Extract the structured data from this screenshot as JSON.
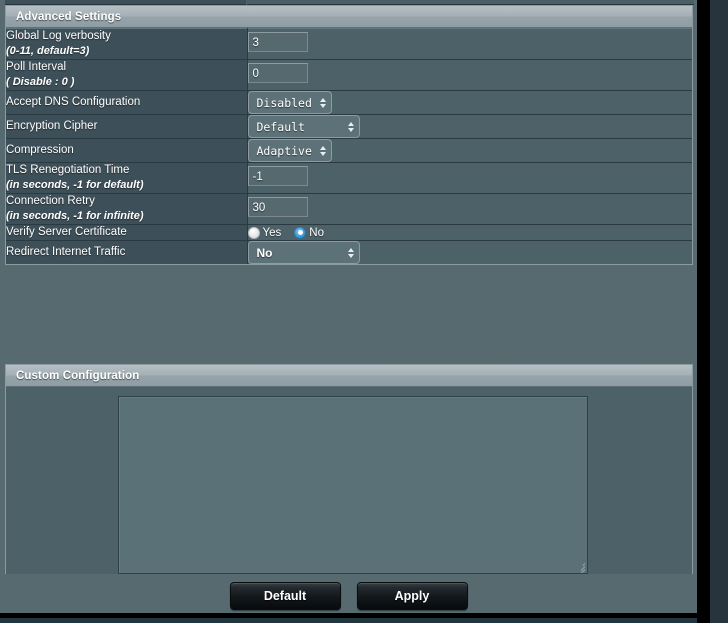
{
  "sections": {
    "advanced": {
      "header": "Advanced Settings",
      "rows": [
        {
          "label": "Global Log verbosity",
          "sublabel": "(0-11, default=3)",
          "control": "text",
          "value": "3"
        },
        {
          "label": "Poll Interval",
          "sublabel": "( Disable : 0 )",
          "control": "text",
          "value": "0"
        },
        {
          "label": "Accept DNS Configuration",
          "sublabel": "",
          "control": "select",
          "value": "Disabled"
        },
        {
          "label": "Encryption Cipher",
          "sublabel": "",
          "control": "select",
          "value": "Default"
        },
        {
          "label": "Compression",
          "sublabel": "",
          "control": "select",
          "value": "Adaptive"
        },
        {
          "label": "TLS Renegotiation Time",
          "sublabel": "(in seconds, -1 for default)",
          "control": "text",
          "value": "-1"
        },
        {
          "label": "Connection Retry",
          "sublabel": "(in seconds, -1 for infinite)",
          "control": "text",
          "value": "30"
        },
        {
          "label": "Verify Server Certificate",
          "sublabel": "",
          "control": "radio",
          "options": [
            "Yes",
            "No"
          ],
          "value": "No"
        },
        {
          "label": "Redirect Internet Traffic",
          "sublabel": "",
          "control": "select",
          "value": "No"
        }
      ]
    },
    "custom": {
      "header": "Custom Configuration",
      "textarea_value": "",
      "textarea_placeholder": ""
    }
  },
  "buttons": {
    "default_label": "Default",
    "apply_label": "Apply"
  },
  "colors": {
    "accent_radio": "#3f9edd",
    "header_gradient_top": "#b5bfc4",
    "panel_background": "#4c6168",
    "label_cell": "#3d4f58",
    "page_background": "#566a70"
  }
}
